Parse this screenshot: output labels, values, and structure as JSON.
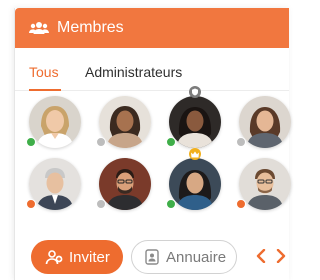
{
  "header": {
    "title": "Membres",
    "icon": "group-icon",
    "color": "#f1773f"
  },
  "tabs": [
    {
      "label": "Tous",
      "active": true
    },
    {
      "label": "Administrateurs",
      "active": false
    }
  ],
  "members": [
    {
      "status": "online",
      "status_color": "#3fae49",
      "badge": null
    },
    {
      "status": "offline",
      "status_color": "#bdbdbd",
      "badge": null
    },
    {
      "status": "online",
      "status_color": "#3fae49",
      "badge": "shield-icon"
    },
    {
      "status": "offline",
      "status_color": "#bdbdbd",
      "badge": null
    },
    {
      "status": "away",
      "status_color": "#ee6c2f",
      "badge": null
    },
    {
      "status": "offline",
      "status_color": "#bdbdbd",
      "badge": null
    },
    {
      "status": "online",
      "status_color": "#3fae49",
      "badge": "crown-icon"
    },
    {
      "status": "away",
      "status_color": "#ee6c2f",
      "badge": null
    }
  ],
  "buttons": {
    "invite": {
      "label": "Inviter",
      "icon": "add-user-icon"
    },
    "directory": {
      "label": "Annuaire",
      "icon": "address-book-icon"
    }
  },
  "pagination": {
    "prev_icon": "chevron-left-icon",
    "next_icon": "chevron-right-icon"
  }
}
